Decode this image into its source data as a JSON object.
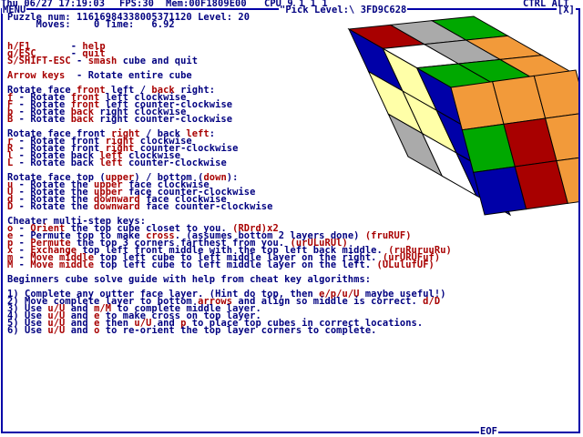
{
  "status_bar": {
    "datetime": "Thu 06/27 17:19:03",
    "fps": "FPS:30",
    "mem": "Mem:00F1809E00",
    "cpu": "CPU 9 1 1 1",
    "keys": "CTRL ALT"
  },
  "window": {
    "menu_label": "MENU",
    "pick_level": "\"Pick Level:\\ 3FD9C628",
    "close_label": "[X]",
    "eof_label": "EOF"
  },
  "puzzle": {
    "line1": "Puzzle num: 11616984338005371120 Level: 20",
    "line2": "     Moves:    0 Time:   6.92"
  },
  "lines": {
    "help_key": "h/F1",
    "help_dash": "       - ",
    "help_word": "help",
    "quit_key": "q/ESC",
    "quit_dash": "      - ",
    "quit_word": "quit",
    "smash_key": "S/SHIFT-ESC",
    "smash_dash": " - ",
    "smash_word": "smash",
    "smash_rest": " cube and quit",
    "arrows_key": "Arrow keys",
    "arrows_rest": "  - Rotate entire cube",
    "rfl_a": "Rotate face ",
    "rfl_front": "front",
    "rfl_b": " left / ",
    "rfl_back": "back",
    "rfl_c": " right:",
    "f1_k": "f",
    "f1_a": " - Rotate ",
    "f1_b": "front",
    "f1_c": " left clockwise",
    "F1_k": "F",
    "F1_a": " - Rotate ",
    "F1_b": "front",
    "F1_c": " left counter-clockwise",
    "b1_k": "b",
    "b1_a": " - Rotate ",
    "b1_b": "back",
    "b1_c": " right clockwise",
    "B1_k": "B",
    "B1_a": " - Rotate ",
    "B1_b": "back",
    "B1_c": " right counter-clockwise",
    "rfr_a": "Rotate face front ",
    "rfr_right": "right",
    "rfr_b": " / back ",
    "rfr_left": "left",
    "rfr_c": ":",
    "r1_k": "r",
    "r1_a": " - Rotate front ",
    "r1_b": "right",
    "r1_c": " clockwise",
    "R1_k": "R",
    "R1_a": " - Rotate front ",
    "R1_b": "right",
    "R1_c": " counter-clockwise",
    "l1_k": "l",
    "l1_a": " - Rotate back ",
    "l1_b": "left",
    "l1_c": " clockwise",
    "L1_k": "L",
    "L1_a": " - Rotate back ",
    "L1_b": "left",
    "L1_c": " counter-clockwise",
    "rtb_a": "Rotate face top (",
    "rtb_upper": "upper",
    "rtb_b": ") / bottom (",
    "rtb_down": "down",
    "rtb_c": "):",
    "u1_k": "u",
    "u1_a": " - Rotate the ",
    "u1_b": "upper",
    "u1_c": " face clockwise",
    "U1_k": "U",
    "U1_a": " - Rotate the ",
    "U1_b": "upper",
    "U1_c": " face counter-clockwise",
    "d1_k": "d",
    "d1_a": " - Rotate the ",
    "d1_b": "downward",
    "d1_c": " face clockwise",
    "D1_k": "D",
    "D1_a": " - Rotate the ",
    "D1_b": "downward",
    "D1_c": " face counter-clockwise",
    "cheater": "Cheater multi-step keys:",
    "o_k": "o",
    "o_a": " - ",
    "o_b": "Orient",
    "o_c": " the top cube closet to you. ",
    "o_d": "(RDrd)x2",
    "e_k": "e",
    "e_a": " - Permute top to make ",
    "e_b": "cross",
    "e_c": ". (assumes bottom 2 layers done) ",
    "e_d": "(fruRUF)",
    "p_k": "p",
    "p_a": " - ",
    "p_b": "Permute",
    "p_c": " the top 3 corners farthest from you. ",
    "p_d": "(urULuRUl)",
    "x_k": "x",
    "x_a": " - ",
    "x_b": "Exchange",
    "x_c": " top left front middle with the top left back middle. ",
    "x_d": "(ruRuruuRu)",
    "m_k": "m",
    "m_a": " - ",
    "m_b": "Move middle",
    "m_c": " top left cube to left middle layer on the right. ",
    "m_d": "(urURUFuf)",
    "M_k": "M",
    "M_a": " - ",
    "M_b": "Move middle",
    "M_c": " top left cube to left middle layer on the left. ",
    "M_d": "(ULulufUF)",
    "guide": "Beginners cube solve guide with help from cheat key algorithms:",
    "g1_a": "1) Complete any outter face layer. (Hint do top, then ",
    "g1_b": "e/p/u/U",
    "g1_c": " maybe useful!)",
    "g2_a": "2) Move complete layer to bottom ",
    "g2_b": "arrows",
    "g2_c": " and align so middle is correct. ",
    "g2_d": "d/D",
    "g3_a": "3) Use ",
    "g3_b": "u/U",
    "g3_c": " and ",
    "g3_d": "m/M",
    "g3_e": " to complete middle layer.",
    "g4_a": "4) Use ",
    "g4_b": "u/U",
    "g4_c": " and ",
    "g4_d": "e",
    "g4_e": " to make cross on top layer.",
    "g5_a": "5) Use ",
    "g5_b": "u/U",
    "g5_c": " and ",
    "g5_d": "e",
    "g5_e": " then ",
    "g5_f": "u/U",
    "g5_g": " and ",
    "g5_h": "p",
    "g5_i": " to place top cubes in correct locations.",
    "g6_a": "6) Use ",
    "g6_b": "u/U",
    "g6_c": " and ",
    "g6_d": "o",
    "g6_e": " to re-orient the top layer corners to complete."
  },
  "cube_colors": {
    "top": [
      "#a80000",
      "#aaaaaa",
      "#00a800",
      "#ffffff",
      "#aaaaaa",
      "#f29a3a",
      "#00a800",
      "#00a800",
      "#f29a3a"
    ],
    "left": [
      "#0000a8",
      "#ffffa8",
      "#0000a8",
      "#ffffa8",
      "#ffffa8",
      "#0000a8",
      "#aaaaaa",
      "#ffffff",
      "#0000a8"
    ],
    "right": [
      "#f29a3a",
      "#f29a3a",
      "#f29a3a",
      "#00a800",
      "#a80000",
      "#f29a3a",
      "#0000a8",
      "#a80000",
      "#f29a3a"
    ]
  }
}
